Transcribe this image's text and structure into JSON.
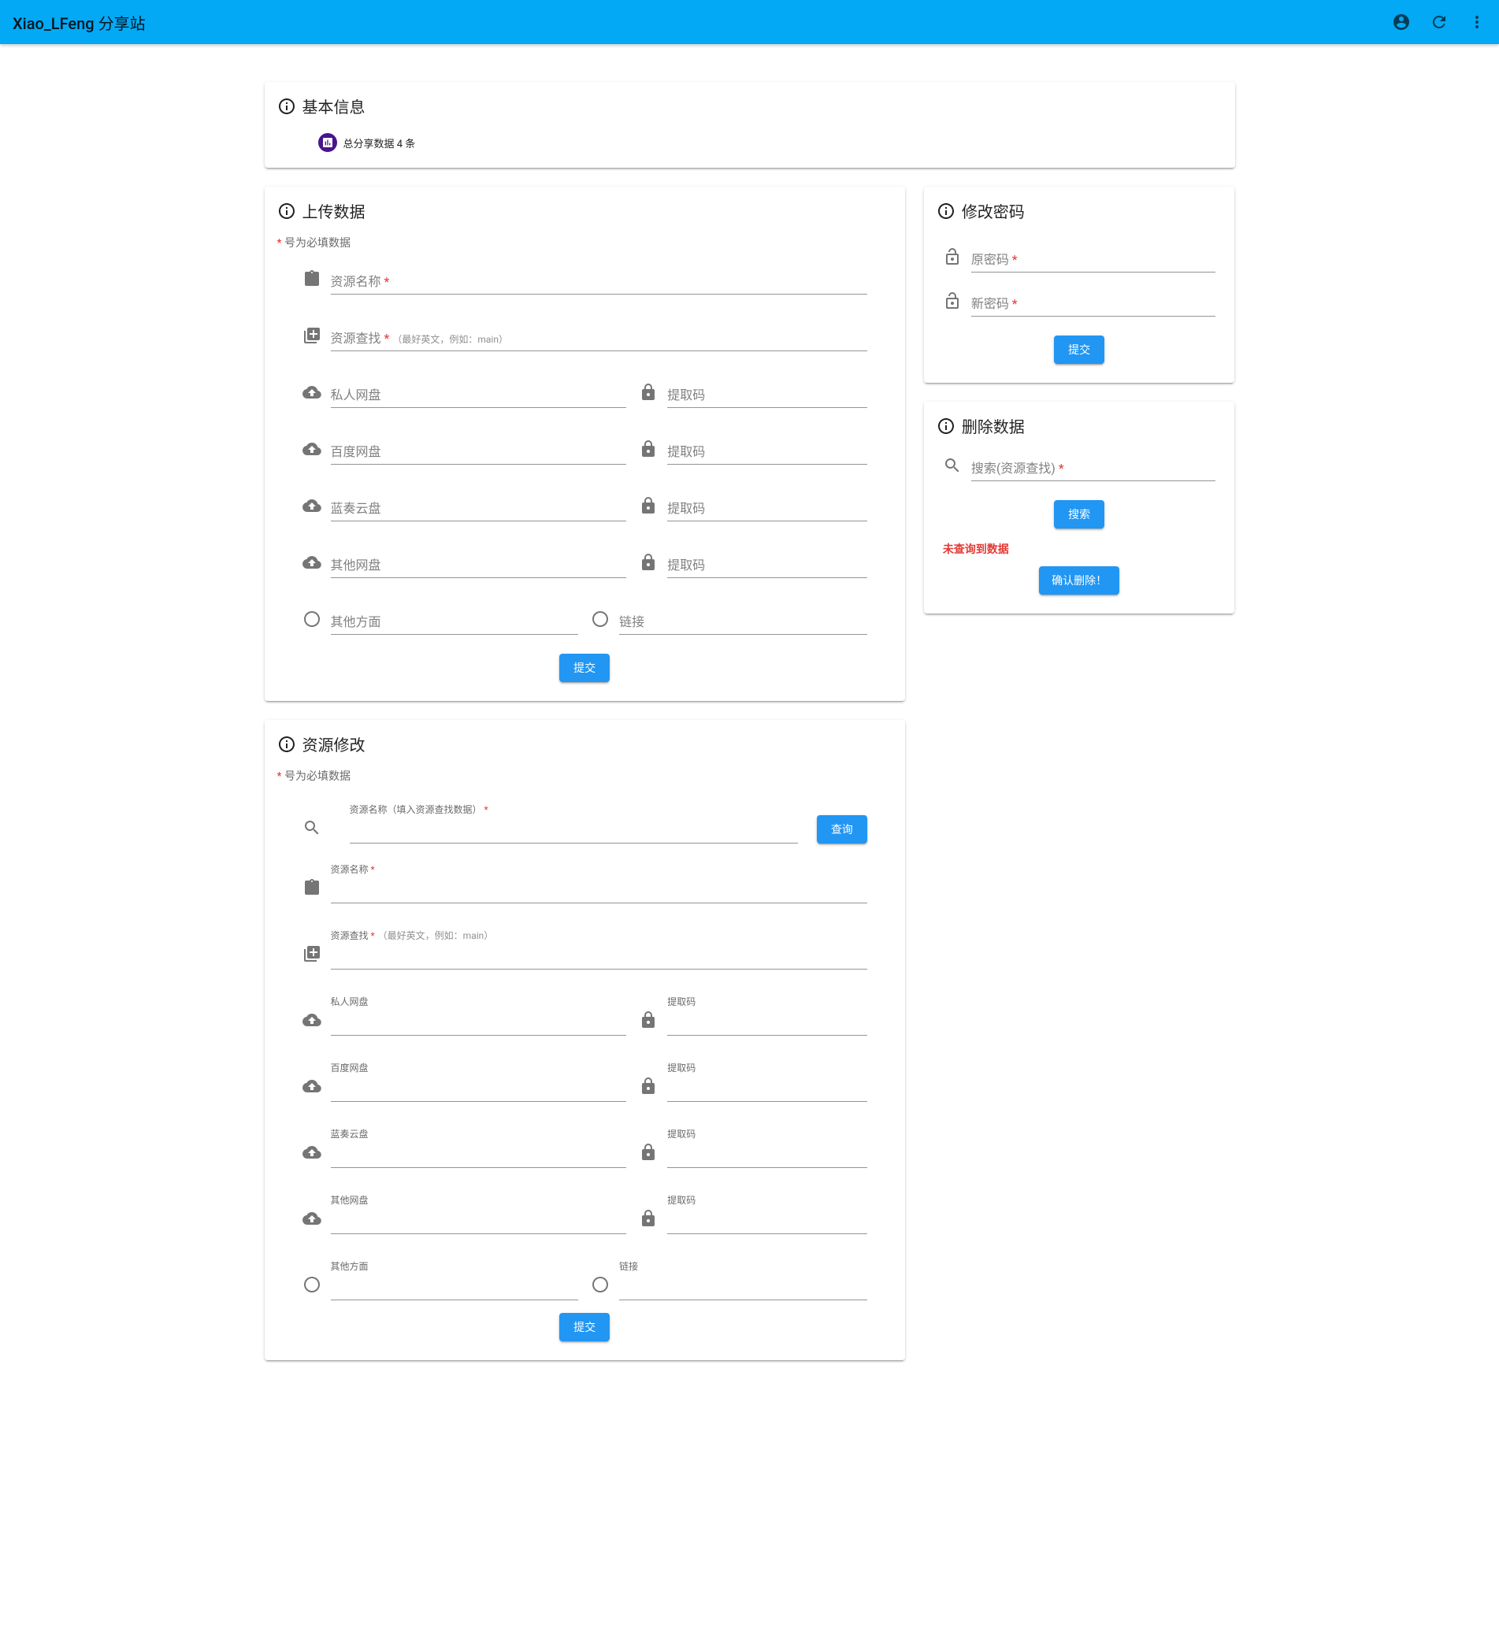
{
  "appbar": {
    "title": "Xiao_LFeng 分享站"
  },
  "basic_info": {
    "title": "基本信息",
    "chip": "总分享数据 4 条"
  },
  "upload": {
    "title": "上传数据",
    "required_note_prefix": "*",
    "required_note": " 号为必填数据",
    "resource_name": "资源名称",
    "resource_find": "资源查找",
    "resource_find_hint": "（最好英文，例如：main）",
    "private_disk": "私人网盘",
    "baidu_disk": "百度网盘",
    "lanzou_disk": "蓝奏云盘",
    "other_disk": "其他网盘",
    "other_aspect": "其他方面",
    "link": "链接",
    "extract_code": "提取码",
    "submit": "提交"
  },
  "change_pwd": {
    "title": "修改密码",
    "old_pwd": "原密码",
    "new_pwd": "新密码",
    "submit": "提交"
  },
  "delete_data": {
    "title": "删除数据",
    "search_label": "搜索(资源查找)",
    "search_btn": "搜索",
    "not_found": "未查询到数据",
    "confirm_delete": "确认删除！"
  },
  "edit": {
    "title": "资源修改",
    "required_note_prefix": "*",
    "required_note": " 号为必填数据",
    "search_label": "资源名称（填入资源查找数据）",
    "query_btn": "查询",
    "resource_name": "资源名称",
    "resource_find": "资源查找",
    "resource_find_hint": "（最好英文，例如：main）",
    "private_disk": "私人网盘",
    "baidu_disk": "百度网盘",
    "lanzou_disk": "蓝奏云盘",
    "other_disk": "其他网盘",
    "other_aspect": "其他方面",
    "link": "链接",
    "extract_code": "提取码",
    "submit": "提交"
  }
}
